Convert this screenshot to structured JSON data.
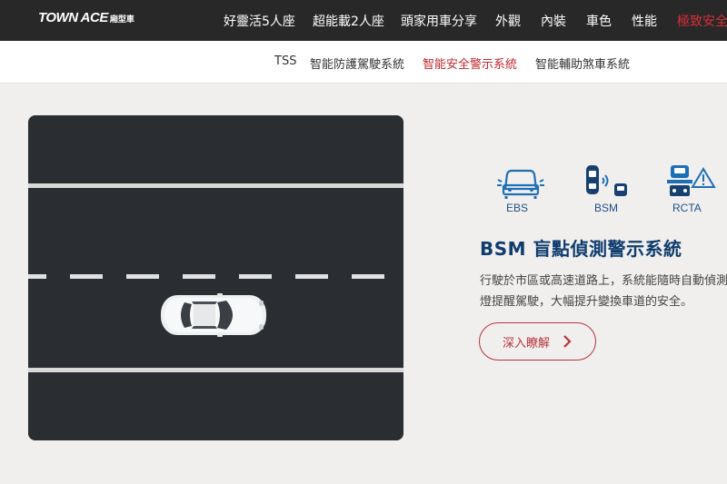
{
  "logo": {
    "main": "TOWN ACE",
    "sub": "廂型車"
  },
  "topnav": [
    {
      "label": "好靈活5人座",
      "active": false
    },
    {
      "label": "超能載2人座",
      "active": false
    },
    {
      "label": "頭家用車分享",
      "active": false
    },
    {
      "label": "外觀",
      "active": false
    },
    {
      "label": "內裝",
      "active": false
    },
    {
      "label": "車色",
      "active": false
    },
    {
      "label": "性能",
      "active": false
    },
    {
      "label": "極致安全",
      "active": true
    }
  ],
  "subnav": [
    {
      "label": "TSS",
      "active": false
    },
    {
      "label": "智能防護駕駛系統",
      "active": false
    },
    {
      "label": "智能安全警示系統",
      "active": true
    },
    {
      "label": "智能輔助煞車系統",
      "active": false
    }
  ],
  "features": [
    {
      "label": "EBS",
      "icon": "car-front-warning-icon"
    },
    {
      "label": "BSM",
      "icon": "blind-spot-icon"
    },
    {
      "label": "RCTA",
      "icon": "rear-cross-traffic-icon"
    }
  ],
  "section": {
    "title": "BSM 盲點偵測警示系統",
    "desc_line1": "行駛於市區或高速道路上，系統能隨時自動偵測",
    "desc_line2": "燈提醒駕駛，大幅提升變換車道的安全。",
    "cta": "深入瞭解"
  },
  "colors": {
    "topbar": "#282828",
    "accent_red": "#c0272d",
    "title_blue": "#0f3c6e",
    "icon_blue": "#1d6fb8",
    "road": "#2a2d31"
  }
}
